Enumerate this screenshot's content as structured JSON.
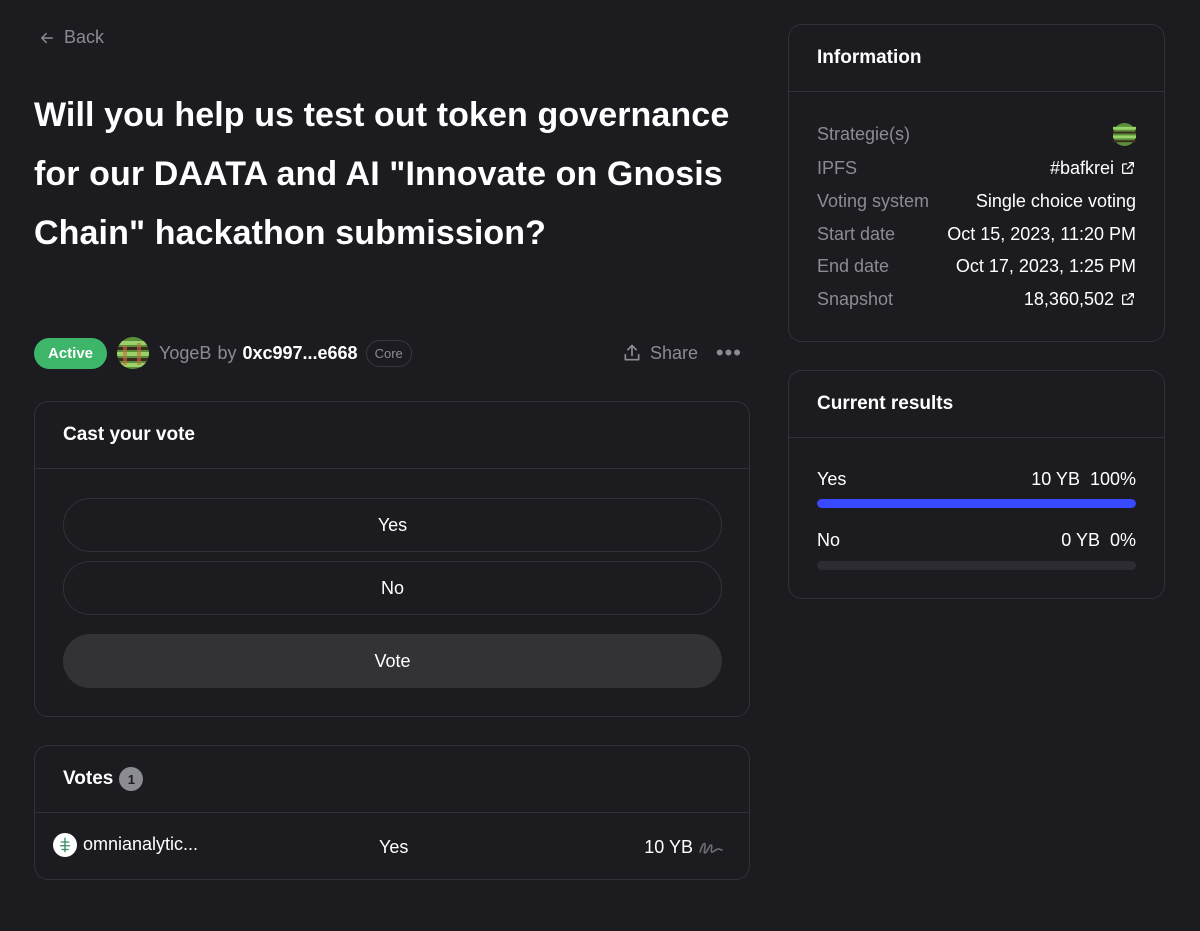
{
  "nav": {
    "back_label": "Back"
  },
  "proposal": {
    "title": "Will you help us test out token governance for our DAATA and AI \"Innovate on Gnosis Chain\" hackathon submission?",
    "status": "Active",
    "space_name": "YogeB",
    "by_label": "by",
    "author": "0xc997...e668",
    "author_badge": "Core",
    "share_label": "Share",
    "more_label": "•••"
  },
  "vote_panel": {
    "heading": "Cast your vote",
    "choices": [
      "Yes",
      "No"
    ],
    "vote_button": "Vote"
  },
  "votes": {
    "heading": "Votes",
    "count": "1",
    "rows": [
      {
        "voter": "omnianalytic...",
        "choice": "Yes",
        "power": "10 YB"
      }
    ]
  },
  "information": {
    "heading": "Information",
    "rows": [
      {
        "label": "Strategie(s)",
        "value": ""
      },
      {
        "label": "IPFS",
        "value": "#bafkrei"
      },
      {
        "label": "Voting system",
        "value": "Single choice voting"
      },
      {
        "label": "Start date",
        "value": "Oct 15, 2023, 11:20 PM"
      },
      {
        "label": "End date",
        "value": "Oct 17, 2023, 1:25 PM"
      },
      {
        "label": "Snapshot",
        "value": "18,360,502"
      }
    ]
  },
  "results": {
    "heading": "Current results",
    "rows": [
      {
        "label": "Yes",
        "power": "10 YB",
        "percent": "100%",
        "fraction": 1.0
      },
      {
        "label": "No",
        "power": "0 YB",
        "percent": "0%",
        "fraction": 0.0
      }
    ]
  },
  "colors": {
    "background": "#1c1b20",
    "accent": "#384aff",
    "active": "#3db66a",
    "muted": "#8b8c92"
  }
}
